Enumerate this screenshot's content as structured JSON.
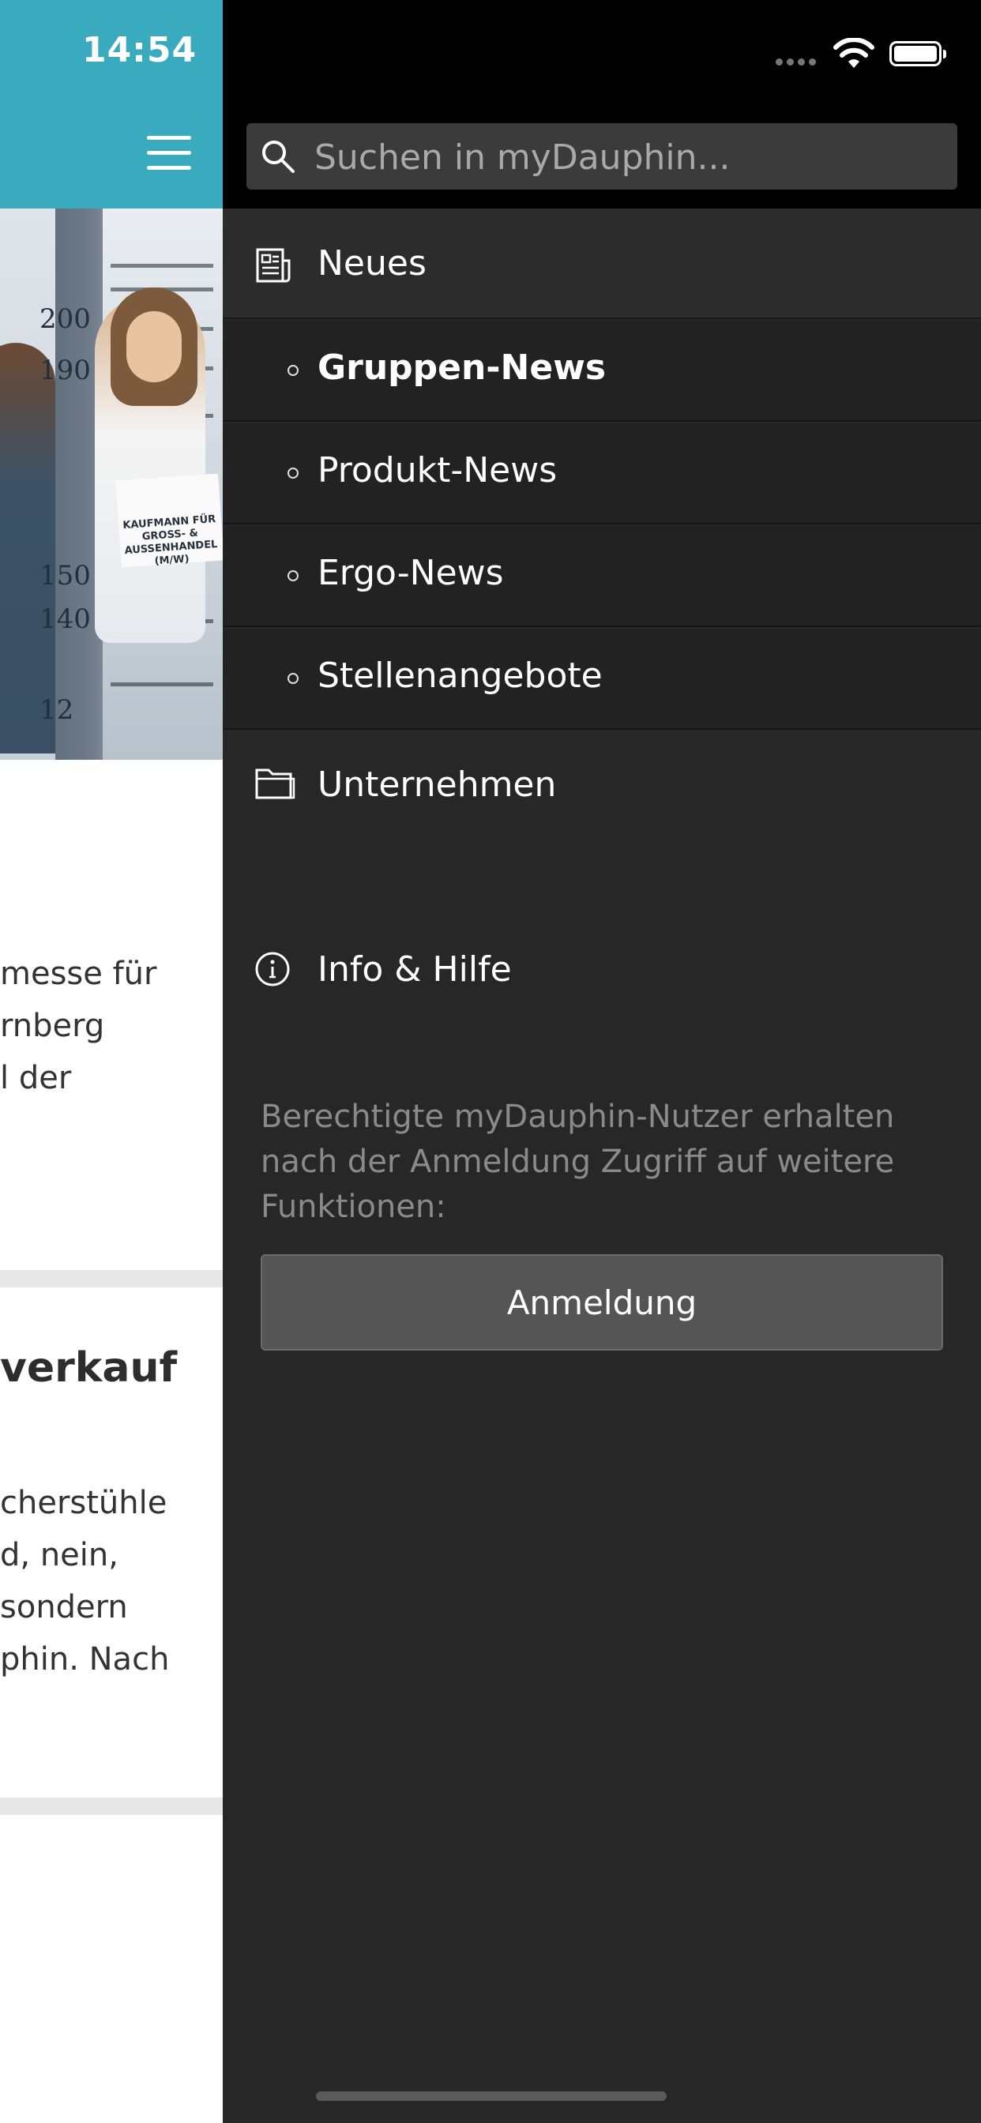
{
  "status_bar": {
    "time": "14:54"
  },
  "background_page": {
    "body_lines_1": [
      "messe für",
      "rnberg",
      "l der"
    ],
    "heading": "verkauf",
    "body_lines_2": [
      "cherstühle",
      "d, nein,",
      "sondern",
      "phin. Nach"
    ],
    "hero_ticks": [
      "200",
      "190",
      "150",
      "140",
      "12"
    ],
    "hero_sign": [
      "KAUFMANN FÜR",
      "GROSS- & AUSSENHANDEL",
      "(M/W)"
    ]
  },
  "drawer": {
    "search": {
      "placeholder": "Suchen in myDauphin..."
    },
    "sections": [
      {
        "label": "Neues",
        "icon": "newspaper-icon"
      },
      {
        "label": "Unternehmen",
        "icon": "folder-icon"
      },
      {
        "label": "Info & Hilfe",
        "icon": "info-icon"
      }
    ],
    "news_items": [
      {
        "label": "Gruppen-News",
        "active": true
      },
      {
        "label": "Produkt-News",
        "active": false
      },
      {
        "label": "Ergo-News",
        "active": false
      },
      {
        "label": "Stellenangebote",
        "active": false
      }
    ],
    "login_note": "Berechtigte myDauphin-Nutzer erhalten nach der Anmeldung Zugriff auf weitere Funktionen:",
    "login_button": "Anmeldung"
  },
  "colors": {
    "header": "#3aabbf",
    "drawer_bg": "#272727"
  }
}
